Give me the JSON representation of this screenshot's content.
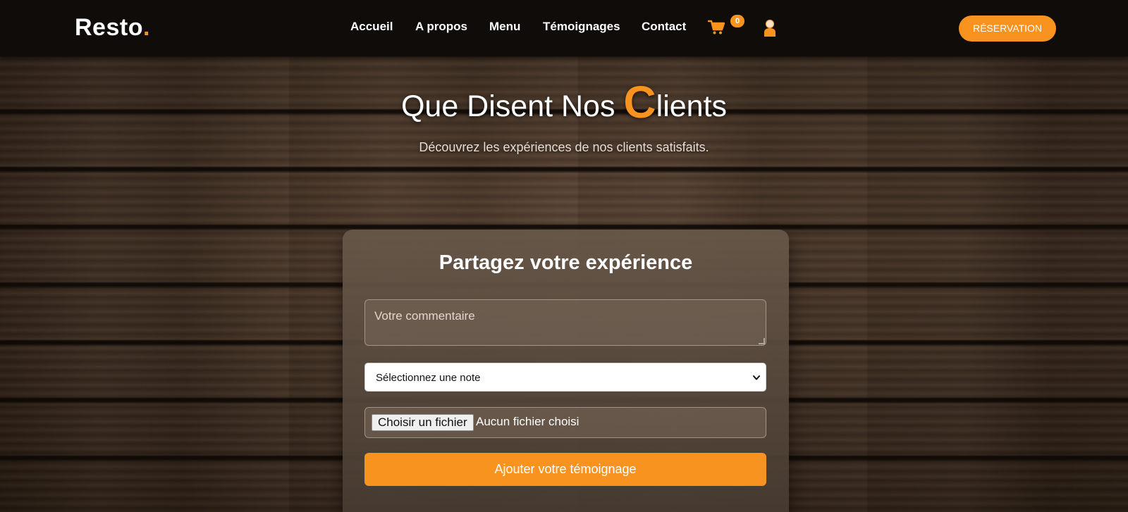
{
  "header": {
    "logo_text": "Resto",
    "logo_dot": ".",
    "nav": [
      "Accueil",
      "A propos",
      "Menu",
      "Témoignages",
      "Contact"
    ],
    "cart_count": "0",
    "cart_icon": "cart-icon",
    "user_icon": "user-icon",
    "reservation_label": "RÉSERVATION"
  },
  "hero": {
    "title_prefix": "Que Disent Nos ",
    "title_highlight": "C",
    "title_suffix": "lients",
    "subtitle": "Découvrez les expériences de nos clients satisfaits."
  },
  "form": {
    "title": "Partagez votre expérience",
    "comment_placeholder": "Votre commentaire",
    "rating_selected": "Sélectionnez une note",
    "file_button": "Choisir un fichier",
    "file_status": "Aucun fichier choisi",
    "submit_label": "Ajouter votre témoignage"
  },
  "colors": {
    "accent": "#f7931e",
    "nav_bg": "#0f0c0a",
    "card_bg": "#5c4c3f"
  }
}
